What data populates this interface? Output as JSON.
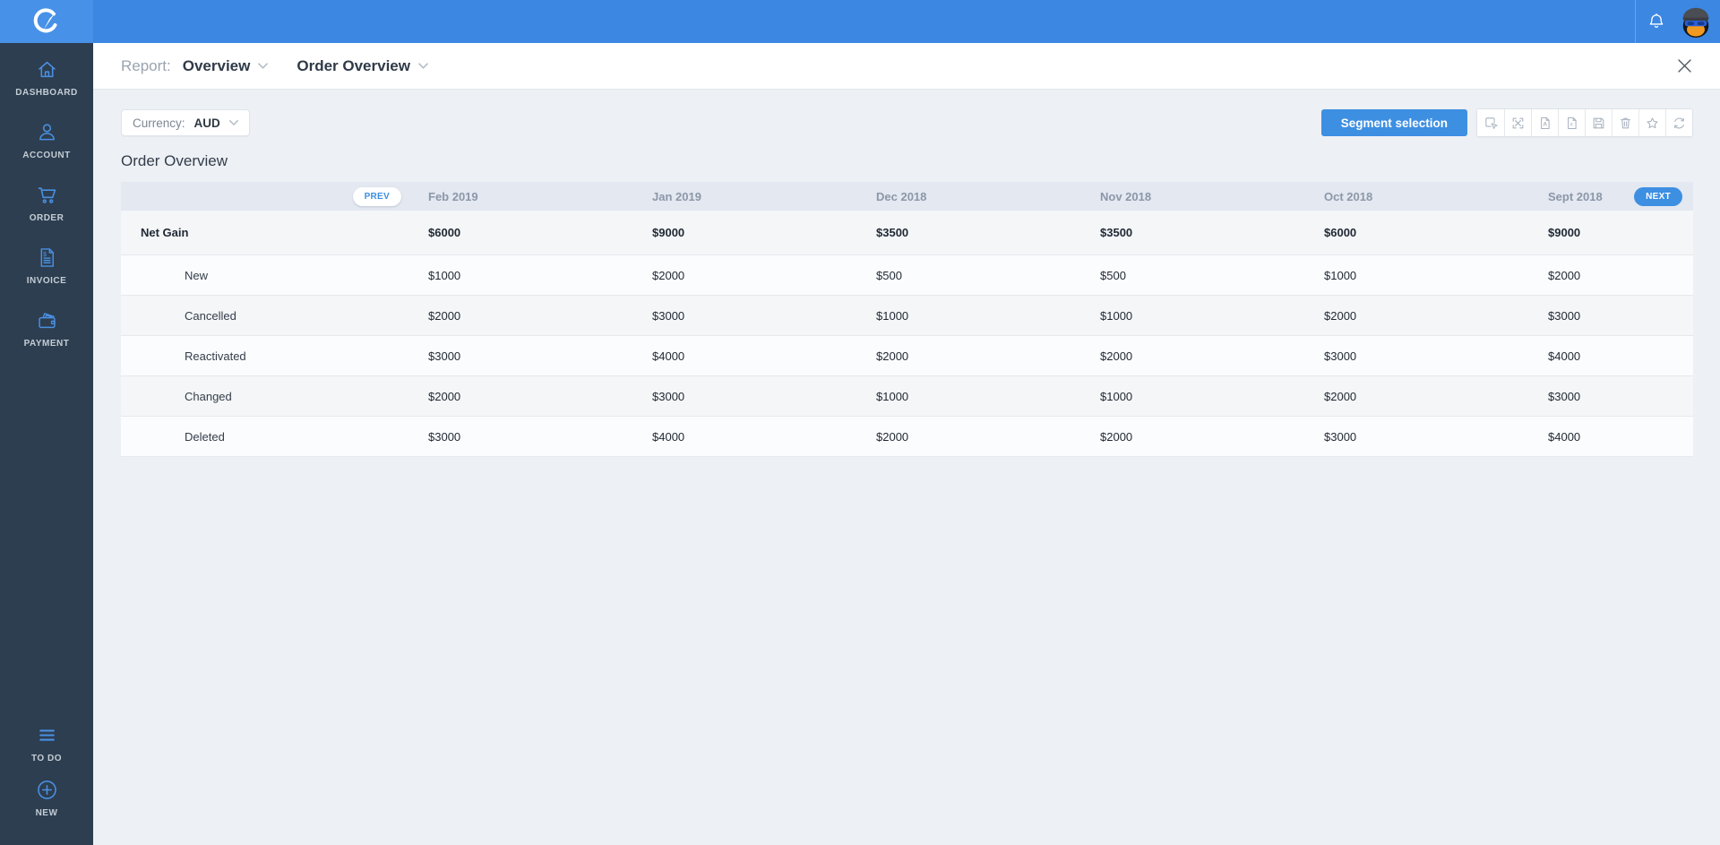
{
  "topbar": {
    "logo_icon": "compass-c-logo",
    "bell_icon": "notifications-bell",
    "avatar": "penguin-user-avatar"
  },
  "sidebar": {
    "items": [
      {
        "label": "DASHBOARD",
        "icon": "home"
      },
      {
        "label": "ACCOUNT",
        "icon": "user"
      },
      {
        "label": "ORDER",
        "icon": "shopping-cart"
      },
      {
        "label": "INVOICE",
        "icon": "invoice-document"
      },
      {
        "label": "PAYMENT",
        "icon": "wallet-cards"
      }
    ],
    "footer_items": [
      {
        "label": "TO DO",
        "icon": "menu-lines"
      },
      {
        "label": "NEW",
        "icon": "plus-circle"
      }
    ]
  },
  "report_bar": {
    "label": "Report:",
    "report_type": "Overview",
    "report_name": "Order Overview"
  },
  "filters": {
    "currency_label": "Currency:",
    "currency_value": "AUD"
  },
  "actions": {
    "segment_button": "Segment selection",
    "toolbar_icons": [
      "select-tool",
      "fullscreen",
      "export-pdf",
      "export-excel",
      "save",
      "delete",
      "favorite",
      "refresh"
    ]
  },
  "page": {
    "title": "Order Overview"
  },
  "table": {
    "prev_label": "PREV",
    "next_label": "NEXT",
    "columns": [
      "Feb 2019",
      "Jan 2019",
      "Dec 2018",
      "Nov 2018",
      "Oct 2018",
      "Sept 2018"
    ],
    "rows": [
      {
        "label": "Net Gain",
        "bold": true,
        "values": [
          "$6000",
          "$9000",
          "$3500",
          "$3500",
          "$6000",
          "$9000"
        ]
      },
      {
        "label": "New",
        "bold": false,
        "values": [
          "$1000",
          "$2000",
          "$500",
          "$500",
          "$1000",
          "$2000"
        ]
      },
      {
        "label": "Cancelled",
        "bold": false,
        "values": [
          "$2000",
          "$3000",
          "$1000",
          "$1000",
          "$2000",
          "$3000"
        ]
      },
      {
        "label": "Reactivated",
        "bold": false,
        "values": [
          "$3000",
          "$4000",
          "$2000",
          "$2000",
          "$3000",
          "$4000"
        ]
      },
      {
        "label": "Changed",
        "bold": false,
        "values": [
          "$2000",
          "$3000",
          "$1000",
          "$1000",
          "$2000",
          "$3000"
        ]
      },
      {
        "label": "Deleted",
        "bold": false,
        "values": [
          "$3000",
          "$4000",
          "$2000",
          "$2000",
          "$3000",
          "$4000"
        ]
      }
    ]
  },
  "colors": {
    "topbar_blue": "#3c87e2",
    "logo_blue": "#4791e8",
    "sidebar_navy": "#2d3e50",
    "accent_blue": "#3d8fe2",
    "page_bg": "#edf0f4",
    "table_header_bg": "#e3e8f1",
    "row_shade": "#f4f6f8",
    "row_light": "#fbfcfe"
  }
}
